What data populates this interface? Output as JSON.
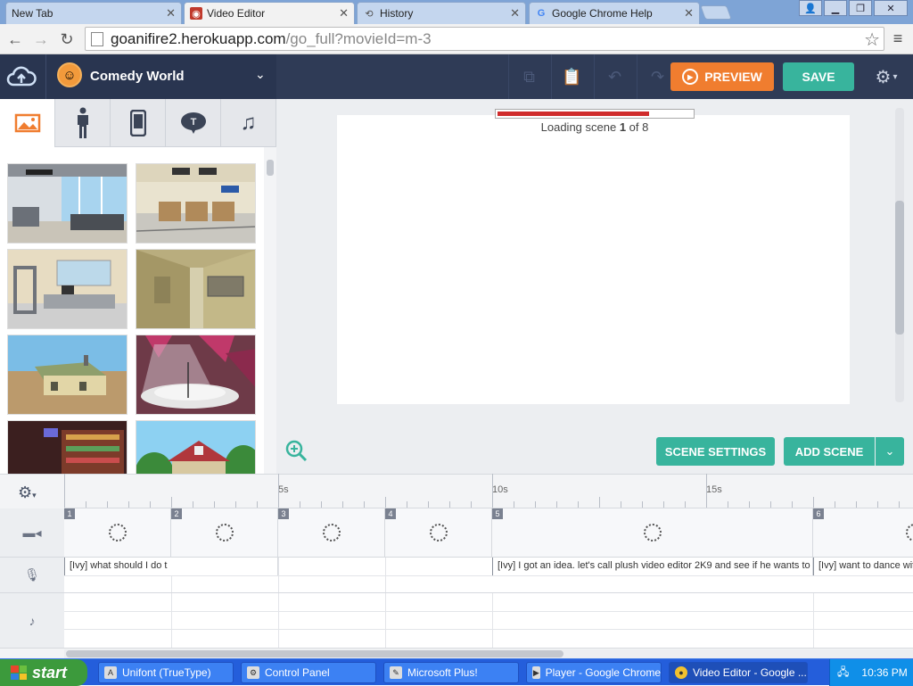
{
  "browser": {
    "tabs": [
      {
        "label": "New Tab",
        "icon": "blank-page-icon",
        "active": false
      },
      {
        "label": "Video Editor",
        "icon": "goanimate-icon",
        "active": true
      },
      {
        "label": "History",
        "icon": "history-icon",
        "active": false
      },
      {
        "label": "Google Chrome Help",
        "icon": "google-icon",
        "active": false
      }
    ],
    "url_host": "goanifire2.herokuapp.com",
    "url_path": "/go_full?movieId=m-3"
  },
  "app": {
    "theme_name": "Comedy World",
    "preview_label": "PREVIEW",
    "save_label": "SAVE",
    "asset_tabs": [
      "image-icon",
      "character-icon",
      "phone-icon",
      "text-bubble-icon",
      "music-icon"
    ],
    "loading_prefix": "Loading scene ",
    "loading_current": "1",
    "loading_suffix": " of 8",
    "loading_progress": 0.78,
    "scene_settings_label": "SCENE SETTINGS",
    "add_scene_label": "ADD SCENE"
  },
  "timeline": {
    "ruler_labels": [
      "5s",
      "10s",
      "15s"
    ],
    "scenes": [
      "1",
      "2",
      "3",
      "4",
      "5",
      "6"
    ],
    "voice_clips": [
      "[Ivy] what should I do t",
      "[Ivy] I got an idea. let's call plush video editor 2K9 and see if he wants to go",
      "[Ivy] want to dance wit"
    ]
  },
  "taskbar": {
    "start_label": "start",
    "items": [
      {
        "label": "Unifont (TrueType)",
        "active": false
      },
      {
        "label": "Control Panel",
        "active": false
      },
      {
        "label": "Microsoft Plus!",
        "active": false
      },
      {
        "label": "Player - Google Chrome",
        "active": false
      },
      {
        "label": "Video Editor - Google ...",
        "active": true
      }
    ],
    "clock": "10:36 PM"
  },
  "colors": {
    "preview_orange": "#f07d2f",
    "save_teal": "#38b49d",
    "header_navy": "#2f3b56",
    "loading_red": "#d02c2c"
  }
}
